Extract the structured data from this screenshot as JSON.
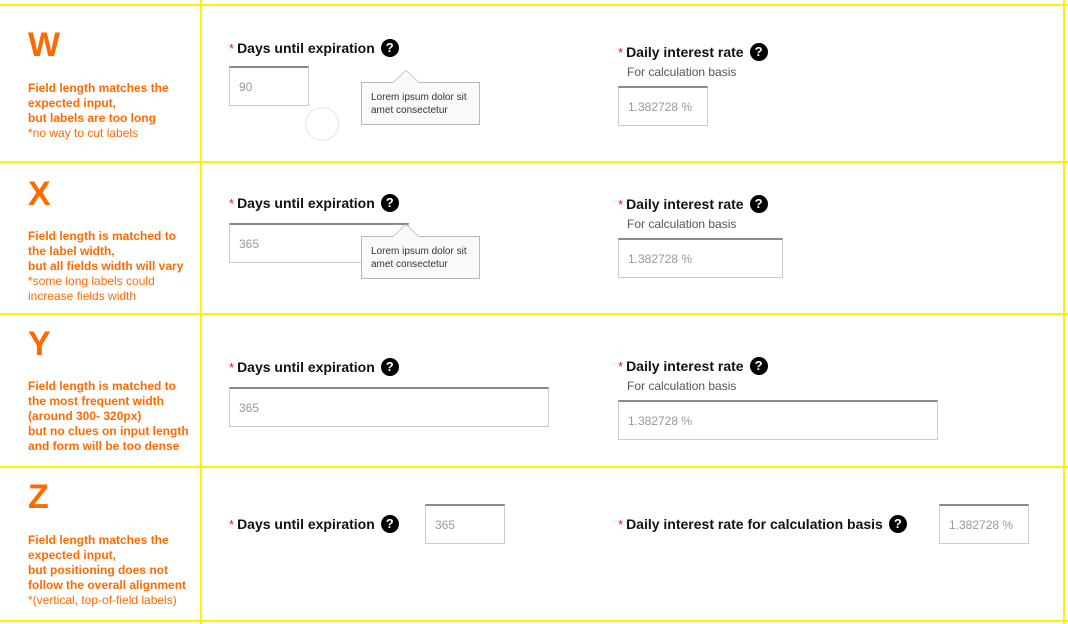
{
  "colors": {
    "accent": "#ff6a00",
    "grid": "#fff200",
    "required": "#e02020"
  },
  "rows": [
    {
      "letter": "W",
      "note_bold": [
        "Field length matches the",
        "expected input,",
        "but labels are too long"
      ],
      "note_plain": [
        "*no way to cut labels"
      ],
      "days_label": "Days until expiration",
      "days_value": "90",
      "tooltip": [
        "Lorem ipsum dolor sit",
        "amet consectetur"
      ],
      "rate_label": "Daily interest rate",
      "rate_sub": "For calculation basis",
      "rate_value": "1.382728 %"
    },
    {
      "letter": "X",
      "note_bold": [
        "Field length is matched to",
        "the label width,",
        "but all fields width will vary"
      ],
      "note_plain": [
        "*some long labels could",
        "increase fields width"
      ],
      "days_label": "Days until expiration",
      "days_value": "365",
      "tooltip": [
        "Lorem ipsum dolor sit",
        "amet consectetur"
      ],
      "rate_label": "Daily interest rate",
      "rate_sub": "For calculation basis",
      "rate_value": "1.382728 %"
    },
    {
      "letter": "Y",
      "note_bold": [
        "Field length is matched to",
        "the most frequent width",
        "(around 300- 320px)",
        "but no clues on input length",
        "and form will be too dense"
      ],
      "note_plain": [],
      "days_label": "Days until expiration",
      "days_value": "365",
      "rate_label": "Daily interest rate",
      "rate_sub": "For calculation basis",
      "rate_value": "1.382728 %"
    },
    {
      "letter": "Z",
      "note_bold": [
        "Field length matches the",
        "expected input,",
        "but positioning does not",
        "follow the overall alignment"
      ],
      "note_plain": [
        "*(vertical, top-of-field labels)"
      ],
      "days_label": "Days until expiration",
      "days_value": "365",
      "rate_label": "Daily interest rate for calculation basis",
      "rate_value": "1.382728 %"
    }
  ],
  "required_mark": "*",
  "help_glyph": "?"
}
